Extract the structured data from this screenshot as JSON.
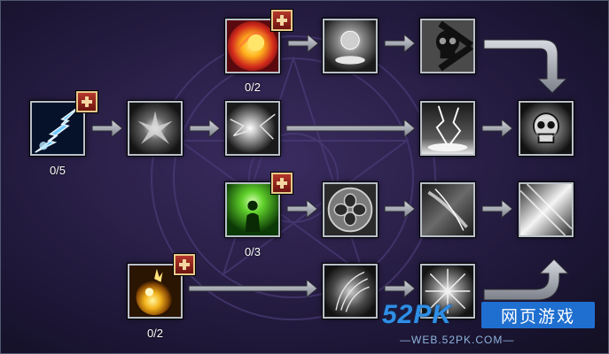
{
  "skill_tree": {
    "points": {
      "lightning_root": "0/5",
      "fire_orb": "0/2",
      "healing_aura": "0/3",
      "holy_orb": "0/2"
    }
  },
  "watermark": {
    "logo": "52PK",
    "cn": "网页游戏",
    "url": "—WEB.52PK.COM—"
  },
  "colors": {
    "background": "#2a2048",
    "arrow": "#9fa3ad",
    "frame": "#b9bfc9",
    "plus": "#b5372a",
    "watermark": "#1f6fd0"
  }
}
